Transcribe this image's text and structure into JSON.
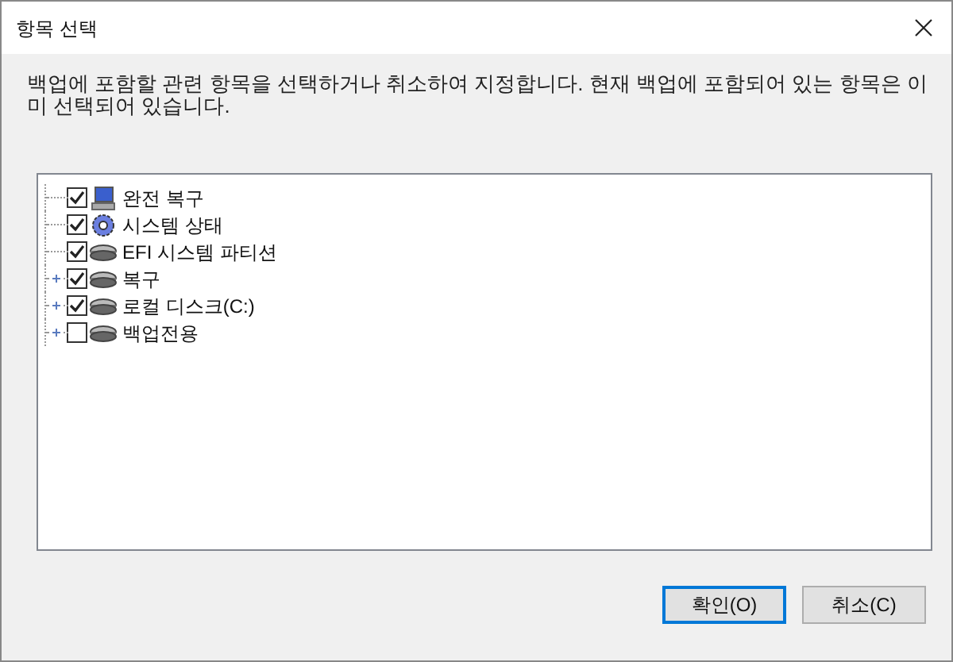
{
  "window": {
    "title": "항목 선택"
  },
  "description": "백업에 포함할 관련 항목을 선택하거나 취소하여 지정합니다. 현재 백업에 포함되어 있는 항목은 이미 선택되어 있습니다.",
  "tree": [
    {
      "label": "완전 복구",
      "kind": "monitor",
      "checked": true,
      "expandable": false
    },
    {
      "label": "시스템 상태",
      "kind": "gear",
      "checked": true,
      "expandable": false
    },
    {
      "label": "EFI 시스템 파티션",
      "kind": "disk",
      "checked": true,
      "expandable": false
    },
    {
      "label": "복구",
      "kind": "disk",
      "checked": true,
      "expandable": true
    },
    {
      "label": "로컬 디스크(C:)",
      "kind": "disk",
      "checked": true,
      "expandable": true
    },
    {
      "label": "백업전용",
      "kind": "disk",
      "checked": false,
      "expandable": true
    }
  ],
  "buttons": [
    {
      "label": "확인(O)",
      "default": true
    },
    {
      "label": "취소(C)",
      "default": false
    }
  ]
}
